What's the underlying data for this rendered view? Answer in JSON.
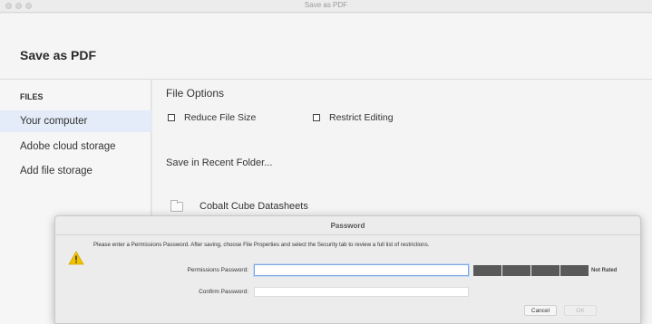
{
  "window": {
    "title": "Save as PDF"
  },
  "header": {
    "title": "Save as PDF"
  },
  "sidebar": {
    "heading": "FILES",
    "items": [
      {
        "label": "Your computer",
        "active": true
      },
      {
        "label": "Adobe cloud storage",
        "active": false
      },
      {
        "label": "Add file storage",
        "active": false
      }
    ]
  },
  "file_options": {
    "title": "File Options",
    "reduce_label": "Reduce File Size",
    "restrict_label": "Restrict Editing"
  },
  "recent": {
    "label": "Save in Recent Folder..."
  },
  "folder": {
    "name": "Cobalt Cube Datasheets"
  },
  "password_dialog": {
    "title": "Password",
    "message": "Please enter a Permissions Password. After saving, choose File Properties and select the Security tab to review a full list of restrictions.",
    "permissions_label": "Permissions Password:",
    "permissions_value": "",
    "confirm_label": "Confirm Password:",
    "confirm_value": "",
    "strength_label": "Not Rated",
    "cancel_label": "Cancel",
    "ok_label": "OK"
  },
  "colors": {
    "accent": "#7aa7e0",
    "sidebar_active": "#e3ecf8",
    "warning": "#f2c200",
    "meter": "#595959"
  },
  "icons": [
    "folder-icon",
    "warning-icon",
    "checkbox-icon"
  ]
}
